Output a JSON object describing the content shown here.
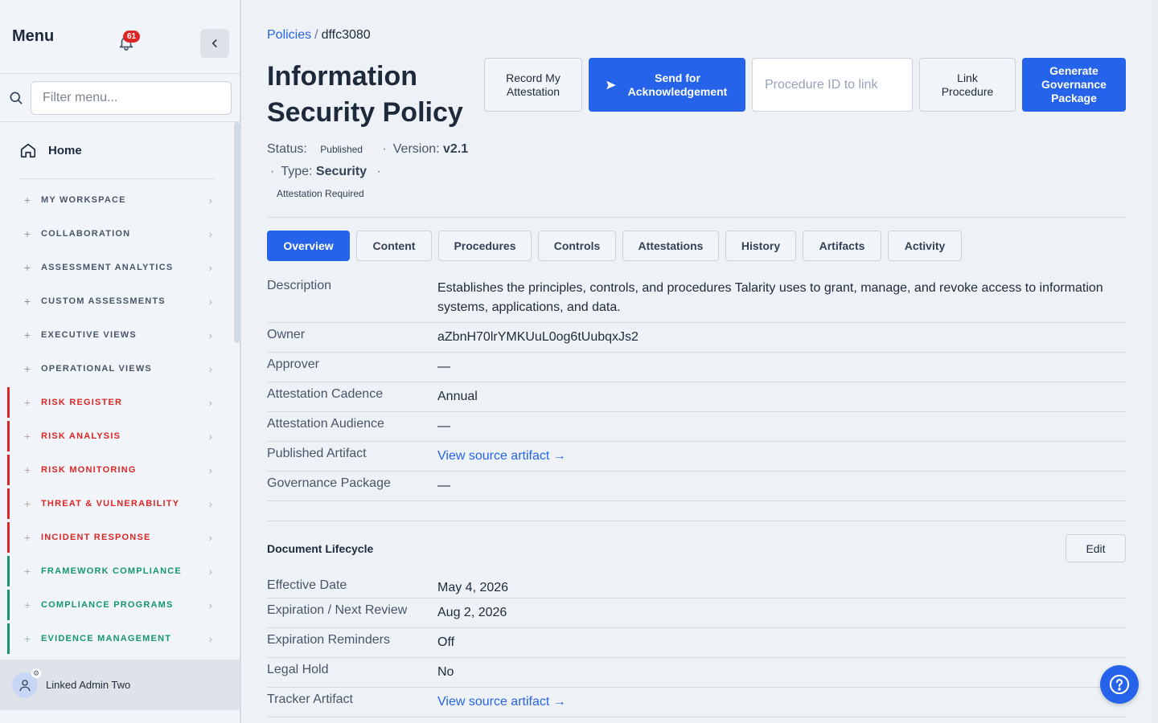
{
  "sidebar": {
    "title": "Menu",
    "notification_count": "61",
    "filter_placeholder": "Filter menu...",
    "home_label": "Home",
    "items": [
      {
        "label": "MY WORKSPACE",
        "group": "default"
      },
      {
        "label": "COLLABORATION",
        "group": "default"
      },
      {
        "label": "ASSESSMENT ANALYTICS",
        "group": "default"
      },
      {
        "label": "CUSTOM ASSESSMENTS",
        "group": "default"
      },
      {
        "label": "EXECUTIVE VIEWS",
        "group": "default"
      },
      {
        "label": "OPERATIONAL VIEWS",
        "group": "default"
      },
      {
        "label": "RISK REGISTER",
        "group": "risk"
      },
      {
        "label": "RISK ANALYSIS",
        "group": "risk"
      },
      {
        "label": "RISK MONITORING",
        "group": "risk"
      },
      {
        "label": "THREAT & VULNERABILITY",
        "group": "risk"
      },
      {
        "label": "INCIDENT RESPONSE",
        "group": "risk"
      },
      {
        "label": "FRAMEWORK COMPLIANCE",
        "group": "compliance"
      },
      {
        "label": "COMPLIANCE PROGRAMS",
        "group": "compliance"
      },
      {
        "label": "EVIDENCE MANAGEMENT",
        "group": "compliance"
      }
    ],
    "user_name": "Linked Admin Two"
  },
  "breadcrumb": {
    "parent": "Policies",
    "separator": "/",
    "current": "dffc3080"
  },
  "policy": {
    "title": "Information Security Policy",
    "status_label": "Status:",
    "status_value": "Published",
    "version_label": "Version:",
    "version_value": "v2.1",
    "type_label": "Type:",
    "type_value": "Security",
    "attestation_note": "Attestation Required"
  },
  "actions": {
    "record_attestation": "Record My Attestation",
    "send_ack": "Send for Acknowledgement",
    "procedure_placeholder": "Procedure ID to link",
    "link_procedure": "Link Procedure",
    "generate_package": "Generate Governance Package"
  },
  "tabs": [
    "Overview",
    "Content",
    "Procedures",
    "Controls",
    "Attestations",
    "History",
    "Artifacts",
    "Activity"
  ],
  "active_tab": "Overview",
  "overview": [
    {
      "key": "Description",
      "value": "Establishes the principles, controls, and procedures Talarity uses to grant, manage, and revoke access to information systems, applications, and data."
    },
    {
      "key": "Owner",
      "value": "aZbnH70lrYMKUuL0og6tUubqxJs2"
    },
    {
      "key": "Approver",
      "value": "—"
    },
    {
      "key": "Attestation Cadence",
      "value": "Annual"
    },
    {
      "key": "Attestation Audience",
      "value": "—"
    },
    {
      "key": "Published Artifact",
      "value": "View source artifact →"
    },
    {
      "key": "Governance Package",
      "value": "—"
    }
  ],
  "lifecycle": {
    "title": "Document Lifecycle",
    "edit_label": "Edit",
    "rows": [
      {
        "key": "Effective Date",
        "value": "May 4, 2026"
      },
      {
        "key": "Expiration / Next Review",
        "value": "Aug 2, 2026"
      },
      {
        "key": "Expiration Reminders",
        "value": "Off"
      },
      {
        "key": "Legal Hold",
        "value": "No"
      },
      {
        "key": "Tracker Artifact",
        "value": "View source artifact →"
      }
    ]
  },
  "colors": {
    "primary": "#2563eb",
    "risk": "#dc2626",
    "compliance": "#159570"
  }
}
